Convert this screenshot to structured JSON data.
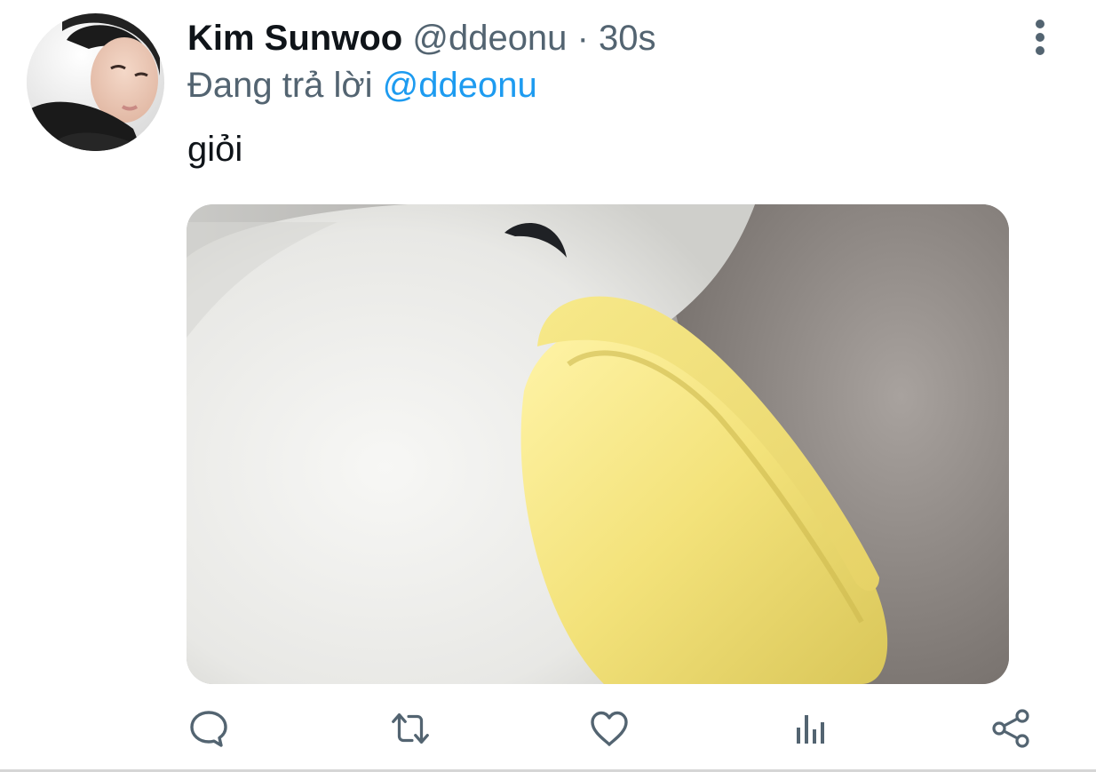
{
  "tweet": {
    "author": {
      "display_name": "Kim Sunwoo",
      "handle": "@ddeonu"
    },
    "separator": "·",
    "time": "30s",
    "reply_to": {
      "prefix": "Đang trả lời",
      "mention": "@ddeonu"
    },
    "text": "giỏi",
    "media": {
      "icon": "plush-duck-photo"
    }
  },
  "actions": {
    "reply_icon": "speech-bubble",
    "retweet_icon": "retweet-arrows",
    "like_icon": "heart-outline",
    "views_icon": "bar-chart",
    "share_icon": "share-nodes"
  },
  "colors": {
    "text_primary": "#0f1419",
    "text_secondary": "#536471",
    "accent": "#1d9bf0",
    "icon": "#536471"
  }
}
